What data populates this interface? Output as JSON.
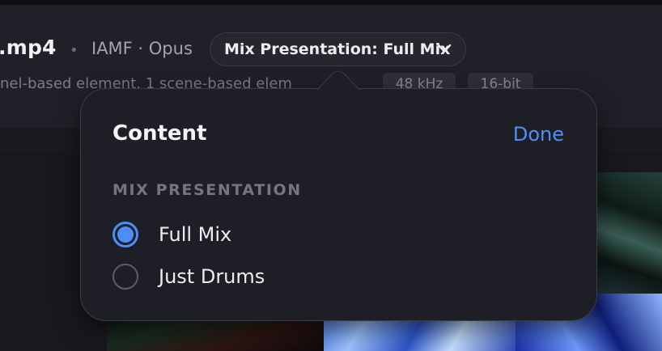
{
  "header": {
    "filename": ".mp4",
    "separator": "•",
    "codec": "IAMF · Opus",
    "mix_button_label": "Mix Presentation: Full Mix",
    "subinfo": "nel-based element, 1 scene-based elem",
    "badges": [
      "48 kHz",
      "16-bit"
    ]
  },
  "popover": {
    "title": "Content",
    "done_label": "Done",
    "section_label": "MIX PRESENTATION",
    "options": [
      {
        "label": "Full Mix",
        "selected": true
      },
      {
        "label": "Just Drums",
        "selected": false
      }
    ]
  },
  "icons": {
    "mix_button": "chevron-down-icon",
    "selected_option": "radio-selected-icon",
    "unselected_option": "radio-unselected-icon"
  },
  "colors": {
    "accent": "#4c8ef7",
    "background": "#17171d",
    "popover": "#1e1e26"
  }
}
